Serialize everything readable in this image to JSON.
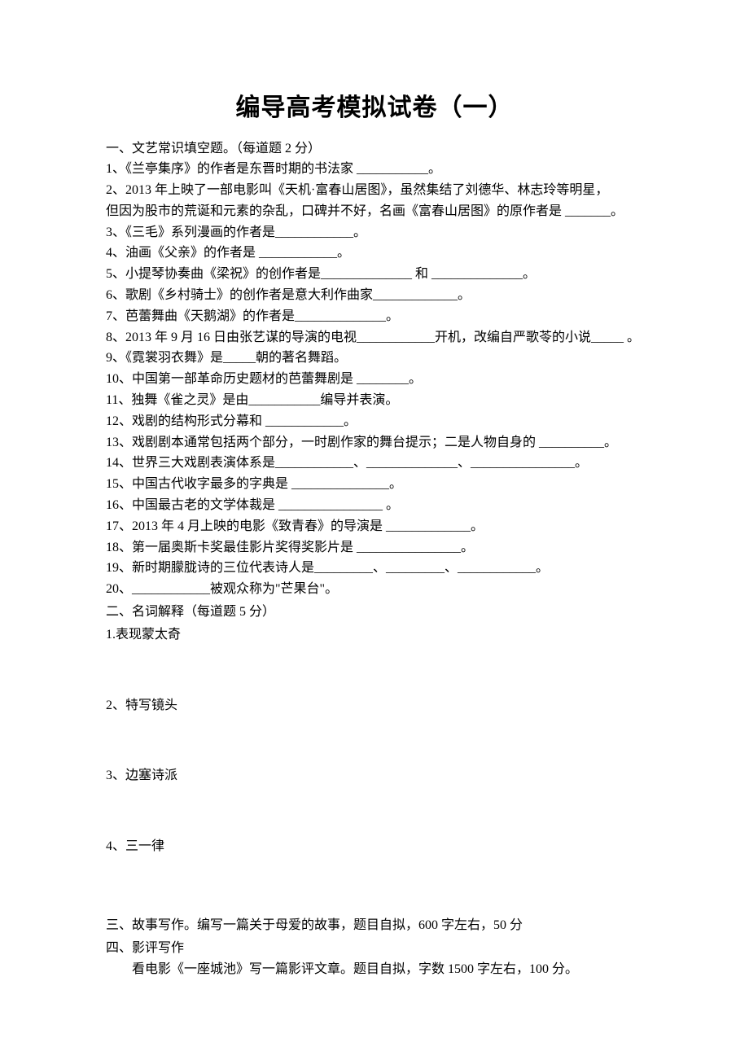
{
  "title": "编导高考模拟试卷（一）",
  "sections": {
    "s1": {
      "heading": "一、文艺常识填空题。（每道题 2 分）",
      "q1": "1、《兰亭集序》的作者是东晋时期的书法家 ___________。",
      "q2a": "2、2013 年上映了一部电影叫《天机·富春山居图》，虽然集结了刘德华、林志玲等明星，",
      "q2b": "但因为股市的荒诞和元素的杂乱，口碑并不好，名画《富春山居图》的原作者是 _______。",
      "q3": "3、《三毛》系列漫画的作者是____________。",
      "q4": "4、油画《父亲》的作者是 ____________。",
      "q5": "5、小提琴协奏曲《梁祝》的创作者是______________  和 ______________。",
      "q6": "6、歌剧《乡村骑士》的创作者是意大利作曲家_____________。",
      "q7": "7、芭蕾舞曲《天鹅湖》的作者是______________。",
      "q8": "8、2013 年 9 月 16 日由张艺谋的导演的电视____________开机，改编自严歌苓的小说_____ 。",
      "q9": "9、《霓裳羽衣舞》是_____朝的著名舞蹈。",
      "q10": "10、中国第一部革命历史题材的芭蕾舞剧是 ________。",
      "q11": "11、独舞《雀之灵》是由___________编导并表演。",
      "q12": "12、戏剧的结构形式分幕和 ____________。",
      "q13": "13、戏剧剧本通常包括两个部分，一时剧作家的舞台提示；二是人物自身的 __________。",
      "q14": "14、世界三大戏剧表演体系是____________、______________、________________。",
      "q15": "15、中国古代收字最多的字典是 _______________。",
      "q16": "16、中国最古老的文学体裁是 ________________ 。",
      "q17": "17、2013 年 4 月上映的电影《致青春》的导演是 _____________。",
      "q18": "18、第一届奥斯卡奖最佳影片奖得奖影片是 ________________。",
      "q19": "19、新时期朦胧诗的三位代表诗人是_________、_________、____________。",
      "q20": "20、____________被观众称为\"芒果台\"。"
    },
    "s2": {
      "heading": "二、名词解释（每道题 5 分）",
      "t1": "1.表现蒙太奇",
      "t2": "2、特写镜头",
      "t3": "3、边塞诗派",
      "t4": "4、三一律"
    },
    "s3": {
      "heading": "三、故事写作。编写一篇关于母爱的故事，题目自拟，600 字左右，50 分"
    },
    "s4": {
      "heading": "四、影评写作",
      "body": "看电影《一座城池》写一篇影评文章。题目自拟，字数 1500 字左右，100 分。"
    }
  }
}
